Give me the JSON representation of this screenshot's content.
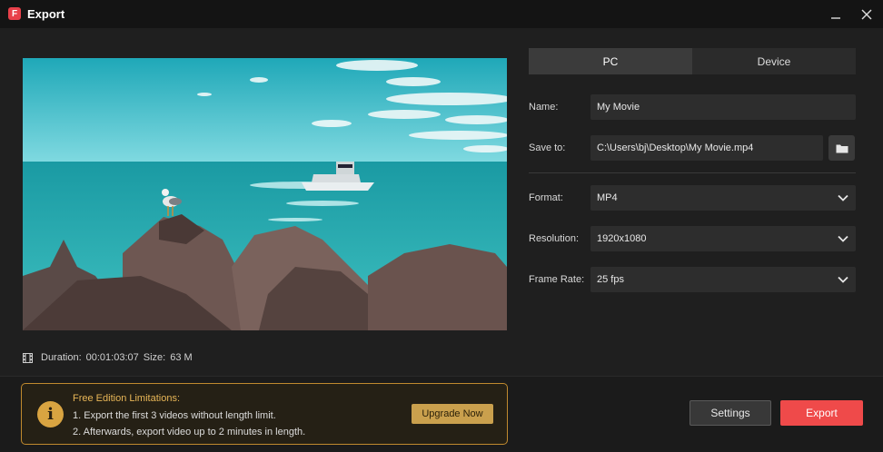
{
  "window": {
    "title": "Export",
    "app_icon_glyph": "F",
    "minimize_icon": "minimize-icon",
    "close_icon": "close-icon"
  },
  "preview": {
    "duration_label": "Duration:",
    "duration_value": "00:01:03:07",
    "size_label": "Size:",
    "size_value": "63 M"
  },
  "tabs": [
    {
      "label": "PC",
      "active": true
    },
    {
      "label": "Device",
      "active": false
    }
  ],
  "form": {
    "name_label": "Name:",
    "name_value": "My Movie",
    "save_label": "Save to:",
    "save_value": "C:\\Users\\bj\\Desktop\\My Movie.mp4",
    "format_label": "Format:",
    "format_value": "MP4",
    "resolution_label": "Resolution:",
    "resolution_value": "1920x1080",
    "framerate_label": "Frame Rate:",
    "framerate_value": "25 fps"
  },
  "limits": {
    "title": "Free Edition Limitations:",
    "line1": "1. Export the first 3 videos without length limit.",
    "line2": "2. Afterwards, export video up to 2 minutes in length.",
    "upgrade_label": "Upgrade Now",
    "icon_glyph": "i"
  },
  "actions": {
    "settings_label": "Settings",
    "export_label": "Export"
  },
  "colors": {
    "accent": "#ef4a4a",
    "warning": "#d9a441"
  }
}
